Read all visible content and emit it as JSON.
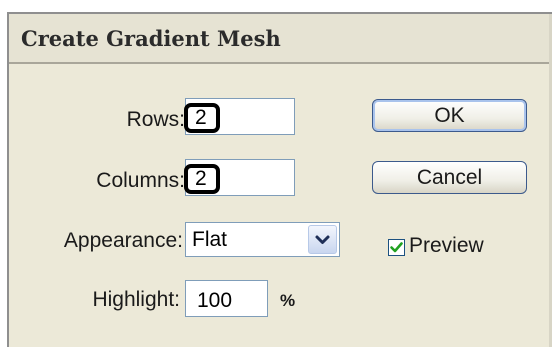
{
  "dialog": {
    "title": "Create Gradient Mesh"
  },
  "fields": {
    "rows": {
      "label": "Rows:",
      "value": "2"
    },
    "columns": {
      "label": "Columns:",
      "value": "2"
    },
    "appearance": {
      "label": "Appearance:",
      "value": "Flat"
    },
    "highlight": {
      "label": "Highlight:",
      "value": "100",
      "unit": "%"
    }
  },
  "buttons": {
    "ok_label": "OK",
    "cancel_label": "Cancel"
  },
  "preview": {
    "label": "Preview",
    "checked": true
  },
  "icons": {
    "dropdown": "chevron-down-icon",
    "checkbox": "checkmark-icon"
  },
  "colors": {
    "dialog_bg": "#ece9d8",
    "title_text": "#2b2b2b",
    "button_border": "#3c5a8c",
    "checkmark": "#21a121"
  }
}
